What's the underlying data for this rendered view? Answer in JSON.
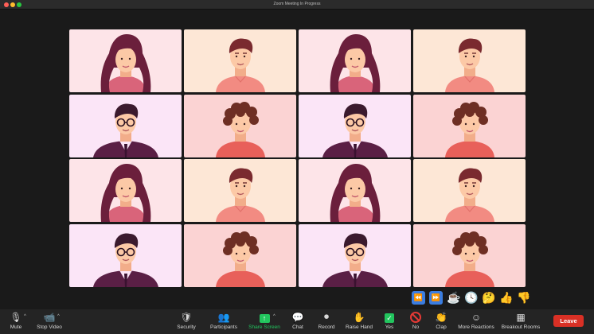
{
  "window": {
    "title": "Zoom Meeting In Progress"
  },
  "tiles": [
    {
      "type": "woman",
      "bg": "#fde4e8",
      "participant": 1
    },
    {
      "type": "man",
      "bg": "#fde7d6",
      "participant": 2
    },
    {
      "type": "woman",
      "bg": "#fde4e8",
      "participant": 3
    },
    {
      "type": "man",
      "bg": "#fde7d6",
      "participant": 4
    },
    {
      "type": "glasses",
      "bg": "#fbe5f7",
      "participant": 5
    },
    {
      "type": "curly",
      "bg": "#fbd3d3",
      "participant": 6
    },
    {
      "type": "glasses",
      "bg": "#fbe5f7",
      "participant": 7
    },
    {
      "type": "curly",
      "bg": "#fbd3d3",
      "participant": 8
    },
    {
      "type": "woman",
      "bg": "#fde4e8",
      "participant": 9
    },
    {
      "type": "man",
      "bg": "#fde7d6",
      "participant": 10
    },
    {
      "type": "woman",
      "bg": "#fde4e8",
      "participant": 11
    },
    {
      "type": "man",
      "bg": "#fde7d6",
      "participant": 12
    },
    {
      "type": "glasses",
      "bg": "#fbe5f7",
      "participant": 13
    },
    {
      "type": "curly",
      "bg": "#fbd3d3",
      "participant": 14
    },
    {
      "type": "glasses",
      "bg": "#fbe5f7",
      "participant": 15
    },
    {
      "type": "curly",
      "bg": "#fbd3d3",
      "participant": 16
    }
  ],
  "reactions": [
    {
      "name": "rewind-icon",
      "glyph": "⏪"
    },
    {
      "name": "fast-forward-icon",
      "glyph": "⏩"
    },
    {
      "name": "coffee-icon",
      "glyph": "☕"
    },
    {
      "name": "clock-icon",
      "glyph": "🕓"
    },
    {
      "name": "thinking-face-icon",
      "glyph": "🤔"
    },
    {
      "name": "thumbs-up-icon",
      "glyph": "👍"
    },
    {
      "name": "thumbs-down-icon",
      "glyph": "👎"
    }
  ],
  "toolbar": {
    "mute": "Mute",
    "stop_video": "Stop Video",
    "security": "Security",
    "participants": "Participants",
    "share_screen": "Share Screen",
    "chat": "Chat",
    "record": "Record",
    "raise_hand": "Raise Hand",
    "yes": "Yes",
    "no": "No",
    "more_reactions": "More Reactions",
    "breakout_rooms": "Breakout Rooms",
    "leave": "Leave"
  },
  "colors": {
    "accent_green": "#22c55e",
    "leave_red": "#d93025"
  }
}
